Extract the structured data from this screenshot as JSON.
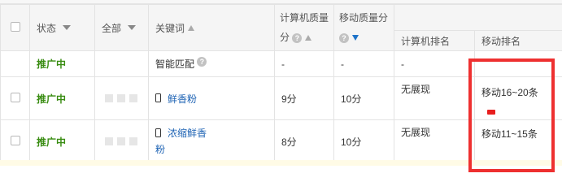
{
  "header": {
    "status": "状态",
    "all": "全部",
    "keyword": "关键词",
    "pc_quality_line1": "计算机质量",
    "pc_quality_line2": "分",
    "mobile_quality_line1": "移动质量分",
    "pc_rank": "计算机排名",
    "mobile_rank": "移动排名"
  },
  "rows": [
    {
      "status": "推广中",
      "keyword": "智能匹配",
      "pc_quality": "-",
      "mobile_quality": "-",
      "pc_rank": "-",
      "mobile_rank": ""
    },
    {
      "status": "推广中",
      "keyword": "鲜香粉",
      "pc_quality": "9分",
      "mobile_quality": "10分",
      "pc_rank": "无展现",
      "mobile_rank": "移动16~20条"
    },
    {
      "status": "推广中",
      "keyword_line1": "浓缩鲜香",
      "keyword_line2": "粉",
      "pc_quality": "8分",
      "mobile_quality": "10分",
      "pc_rank": "无展现",
      "mobile_rank": "移动11~15条"
    }
  ],
  "icons": {
    "sort_desc": "triangle-down-icon",
    "sort_up": "arrow-up-icon",
    "sort_down_active": "arrow-down-icon",
    "help": "question-mark-icon",
    "device": "mobile-phone-icon"
  },
  "colors": {
    "status_green": "#3a8d13",
    "link_blue": "#1e63b4",
    "highlight_red": "#ee3030"
  }
}
